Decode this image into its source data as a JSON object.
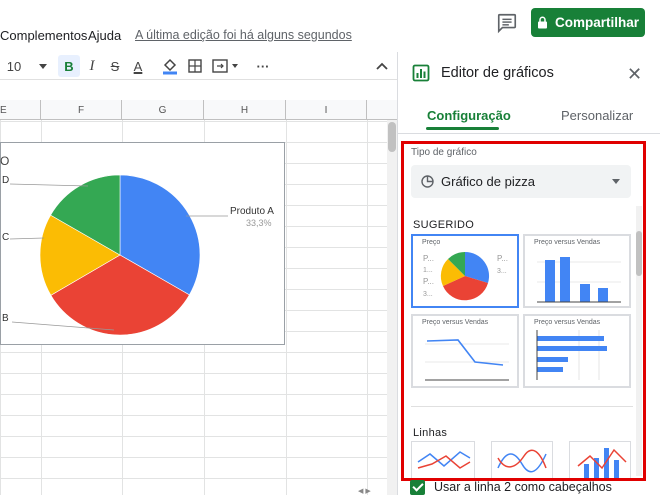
{
  "menu": {
    "items": [
      "Complementos",
      "Ajuda"
    ],
    "last_edit": "A última edição foi há alguns segundos"
  },
  "header": {
    "share_label": "Compartilhar"
  },
  "toolbar": {
    "font_size": "10",
    "bold": "B",
    "italic": "I",
    "strike": "S",
    "text_color": "A",
    "more": "···",
    "collapse": "^"
  },
  "sheet": {
    "columns": [
      "E",
      "F",
      "G",
      "H",
      "I"
    ]
  },
  "chart": {
    "title_fragment": "O",
    "labels": [
      {
        "text": "Produto A",
        "pct": "33,3%"
      },
      {
        "text": "D"
      },
      {
        "text": "C"
      },
      {
        "text": "B"
      }
    ],
    "colors": {
      "a": "#4285f4",
      "b": "#ea4335",
      "c": "#fbbc04",
      "d": "#34a853"
    }
  },
  "chart_data": {
    "type": "pie",
    "categories": [
      "Produto A",
      "Produto B",
      "Produto C",
      "Produto D"
    ],
    "values": [
      33.3,
      33.3,
      16.7,
      16.7
    ]
  },
  "panel": {
    "title": "Editor de gráficos",
    "tabs": [
      "Configuração",
      "Personalizar"
    ],
    "chart_type_label": "Tipo de gráfico",
    "chart_type_value": "Gráfico de pizza",
    "suggested_label": "SUGERIDO",
    "thumbs": [
      {
        "title": "Preço",
        "frag": [
          "P...",
          "1...",
          "P...",
          "3...",
          "P...",
          "3..."
        ]
      },
      {
        "title": "Preço versus Vendas"
      },
      {
        "title": "Preço versus Vendas"
      },
      {
        "title": "Preço versus Vendas"
      }
    ],
    "lines_label": "Linhas",
    "checkbox_label": "Usar a linha 2 como cabeçalhos"
  }
}
